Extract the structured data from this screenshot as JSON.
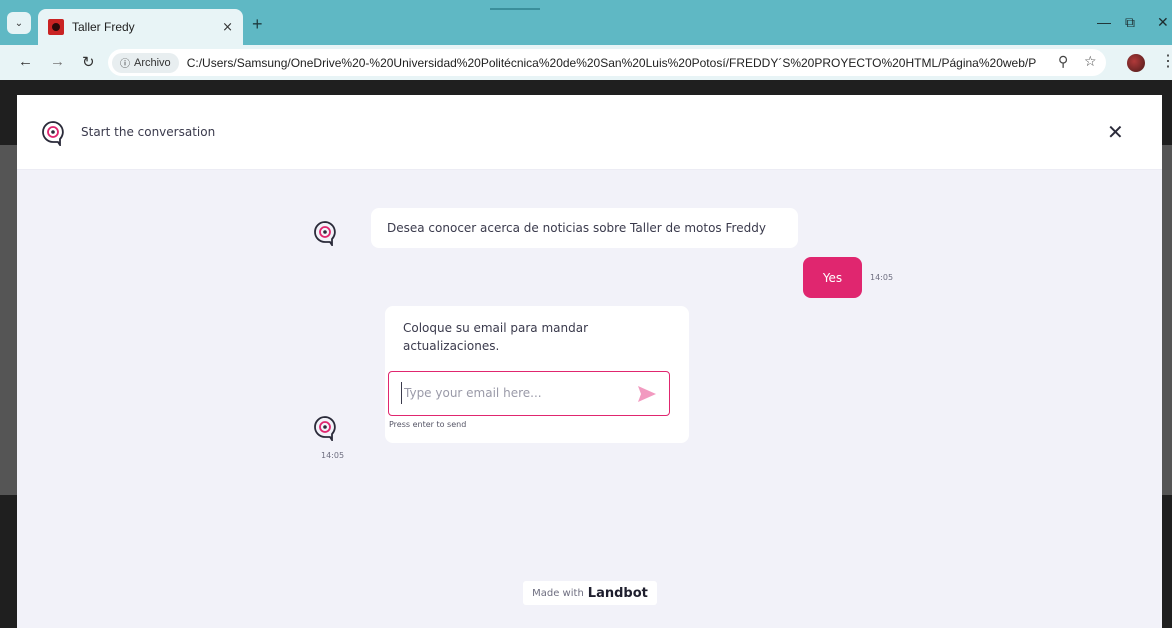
{
  "browser": {
    "tab_title": "Taller Fredy",
    "tab_close_icon": "×",
    "new_tab_icon": "+",
    "security_chip": "Archivo",
    "url": "C:/Users/Samsung/OneDrive%20-%20Universidad%20Politécnica%20de%20San%20Luis%20Potosí/FREDDY´S%20PROYECTO%20HTML/Página%20web/Proyect...",
    "theme_color": "#5fb8c4"
  },
  "chat": {
    "header_title": "Start the conversation",
    "messages": [
      {
        "from": "bot",
        "text": "Desea conocer acerca de noticias sobre Taller de motos Freddy"
      },
      {
        "from": "user",
        "text": "Yes",
        "time": "14:05"
      },
      {
        "from": "bot",
        "text": "Coloque su email para mandar actualizaciones.",
        "time": "14:05"
      }
    ],
    "email_placeholder": "Type your email here...",
    "hint": "Press enter to send",
    "made_with": "Made with",
    "brand_name": "Landbot",
    "accent_color": "#e0266f"
  }
}
